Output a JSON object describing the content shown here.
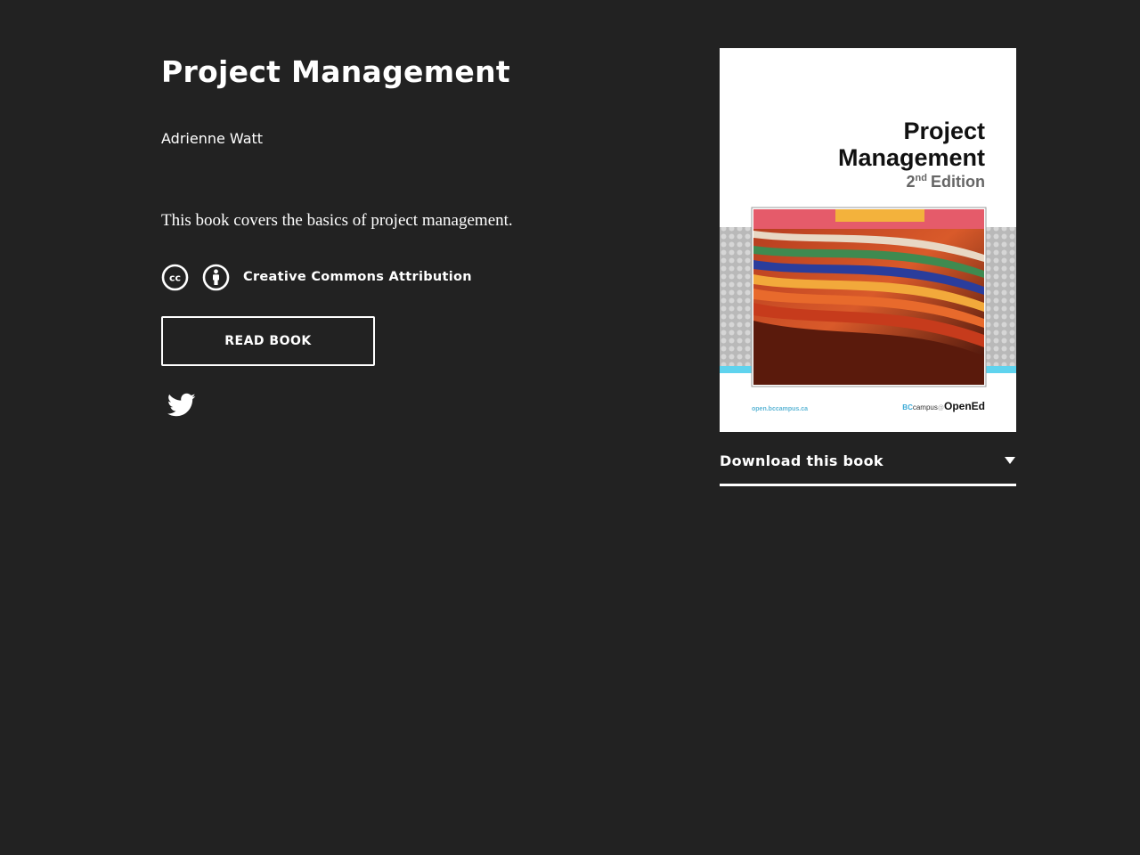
{
  "book": {
    "title": "Project Management",
    "author": "Adrienne Watt",
    "description": "This book covers the basics of project management.",
    "license": "Creative Commons Attribution",
    "read_button": "READ BOOK",
    "download_label": "Download this book"
  },
  "cover": {
    "title_line1": "Project",
    "title_line2": "Management",
    "edition_num": "2",
    "edition_sup": "nd",
    "edition_word": "Edition",
    "url": "open.bccampus.ca",
    "brand_bc": "BC",
    "brand_campus": "campus",
    "brand_at": "@",
    "brand_opened": "OpenEd"
  },
  "icons": {
    "cc": "creative-commons-icon",
    "by": "attribution-icon",
    "twitter": "twitter-icon",
    "caret": "chevron-down-icon"
  },
  "colors": {
    "background": "#222222",
    "text": "#ffffff",
    "cover_accent": "#5fd3ee"
  }
}
